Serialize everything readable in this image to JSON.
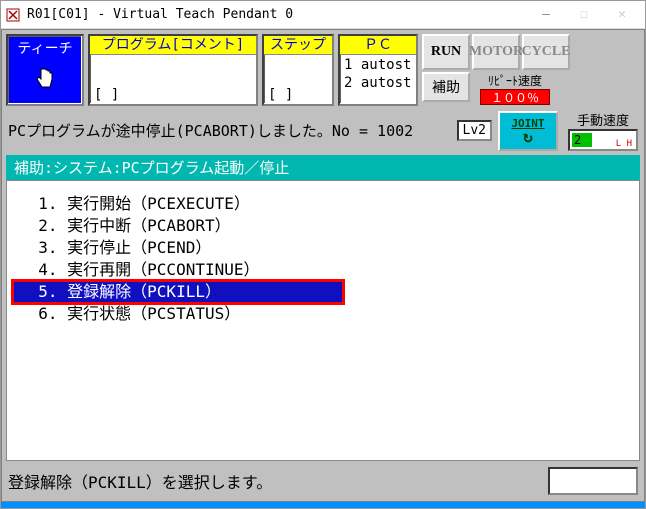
{
  "window": {
    "title": "R01[C01] - Virtual Teach Pendant 0"
  },
  "top": {
    "teach_label": "ティーチ",
    "program_head": "プログラム[コメント]",
    "program_brackets": "[                 ]",
    "step_head": "ステップ",
    "step_brackets": "[       ]",
    "pc_head": "ＰＣ",
    "pc_lines": [
      "1 autost",
      "2 autost"
    ],
    "run_btn": "RUN",
    "motor_btn": "MOTOR",
    "cycle_btn": "CYCLE",
    "aux_btn": "補助",
    "repeat_label": "ﾘﾋﾟｰﾄ速度",
    "repeat_value": "１００％",
    "manual_label": "手動速度",
    "manual_value": "2"
  },
  "status": {
    "message": "PCプログラムが途中停止(PCABORT)しました。No = 1002",
    "lv": "Lv2",
    "joint": "JOINT"
  },
  "menu": {
    "title": "補助:システム:PCプログラム起動／停止",
    "items": [
      {
        "num": "1.",
        "label": "実行開始（PCEXECUTE）"
      },
      {
        "num": "2.",
        "label": "実行中断（PCABORT）"
      },
      {
        "num": "3.",
        "label": "実行停止（PCEND）"
      },
      {
        "num": "4.",
        "label": "実行再開（PCCONTINUE）"
      },
      {
        "num": "5.",
        "label": "登録解除（PCKILL）"
      },
      {
        "num": "6.",
        "label": "実行状態（PCSTATUS）"
      }
    ],
    "selected_index": 4
  },
  "bottom": {
    "prompt": "登録解除（PCKILL）を選択します。"
  }
}
